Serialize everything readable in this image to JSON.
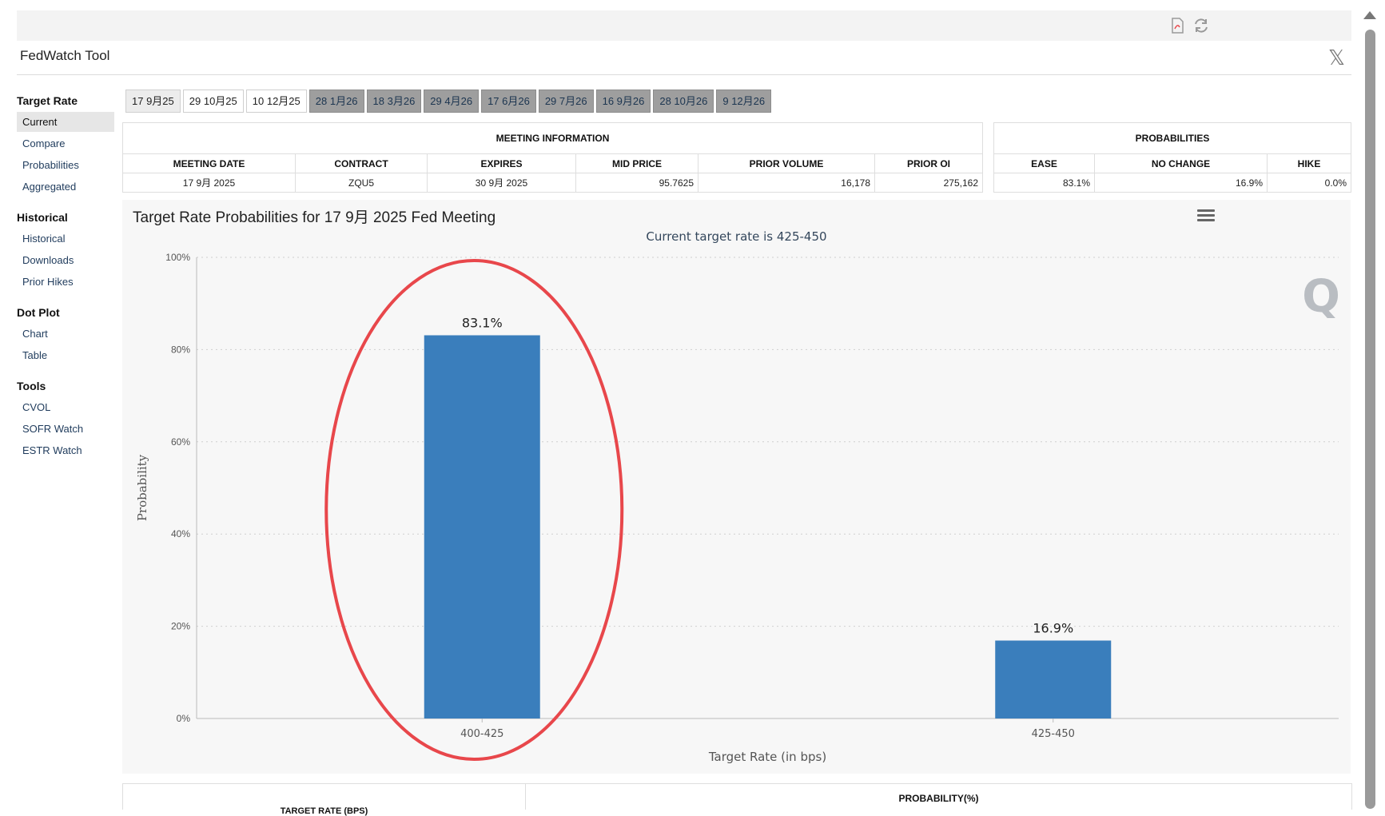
{
  "app": {
    "title": "FedWatch Tool"
  },
  "toolbar": {
    "icons": [
      "pdf-icon",
      "refresh-icon"
    ]
  },
  "sidebar": {
    "groups": [
      {
        "heading": "Target Rate",
        "items": [
          "Current",
          "Compare",
          "Probabilities",
          "Aggregated"
        ]
      },
      {
        "heading": "Historical",
        "items": [
          "Historical",
          "Downloads",
          "Prior Hikes"
        ]
      },
      {
        "heading": "Dot Plot",
        "items": [
          "Chart",
          "Table"
        ]
      },
      {
        "heading": "Tools",
        "items": [
          "CVOL",
          "SOFR Watch",
          "ESTR Watch"
        ]
      }
    ],
    "active": "Current"
  },
  "meeting_tabs": [
    "17 9月25",
    "29 10月25",
    "10 12月25",
    "28 1月26",
    "18 3月26",
    "29 4月26",
    "17 6月26",
    "29 7月26",
    "16 9月26",
    "28 10月26",
    "9 12月26"
  ],
  "selected_tab": "17 9月25",
  "meeting_info": {
    "heading": "MEETING INFORMATION",
    "columns": [
      "MEETING DATE",
      "CONTRACT",
      "EXPIRES",
      "MID PRICE",
      "PRIOR VOLUME",
      "PRIOR OI"
    ],
    "row": [
      "17 9月 2025",
      "ZQU5",
      "30 9月 2025",
      "95.7625",
      "16,178",
      "275,162"
    ]
  },
  "probabilities": {
    "heading": "PROBABILITIES",
    "columns": [
      "EASE",
      "NO CHANGE",
      "HIKE"
    ],
    "row": [
      "83.1%",
      "16.9%",
      "0.0%"
    ]
  },
  "chart_data": {
    "type": "bar",
    "title": "Target Rate Probabilities for 17 9月 2025 Fed Meeting",
    "subtitle": "Current target rate is 425-450",
    "xlabel": "Target Rate (in bps)",
    "ylabel": "Probability",
    "categories": [
      "400-425",
      "425-450"
    ],
    "values": [
      83.1,
      16.9
    ],
    "data_labels": [
      "83.1%",
      "16.9%"
    ],
    "ylim": [
      0,
      100
    ],
    "yticks": [
      0,
      20,
      40,
      60,
      80,
      100
    ],
    "ytick_labels": [
      "0%",
      "20%",
      "40%",
      "60%",
      "80%",
      "100%"
    ],
    "grid": true,
    "bar_color": "#3a7ebc",
    "highlight": {
      "category": "400-425",
      "shape": "ellipse",
      "color": "#e8474b"
    }
  },
  "bottom_table": {
    "columns": [
      "TARGET RATE (BPS)",
      "PROBABILITY(%)"
    ]
  }
}
